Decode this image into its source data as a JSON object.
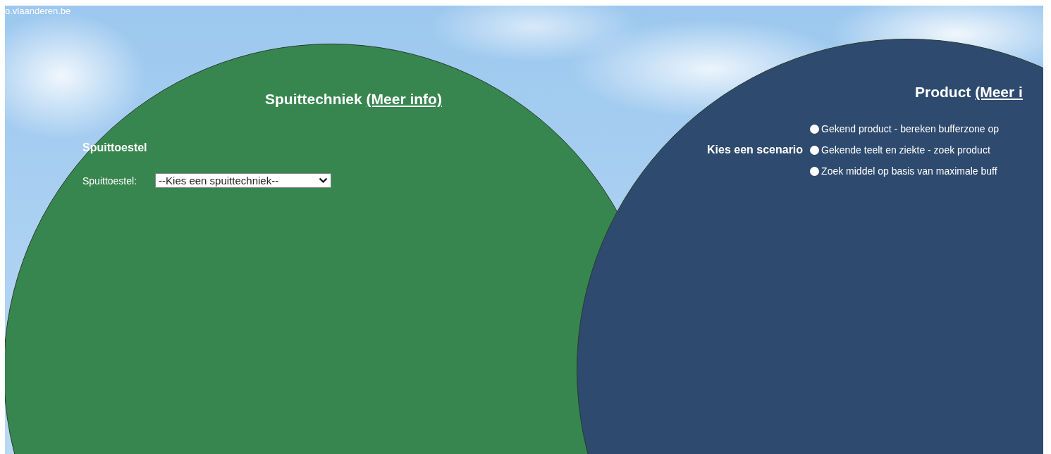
{
  "address_text": "o.vlaanderen.be",
  "spray_panel": {
    "title": "Spuittechniek",
    "info_link": "(Meer info)",
    "section_heading": "Spuittoestel",
    "field_label": "Spuittoestel:",
    "select_value": "--Kies een spuittechniek--"
  },
  "product_panel": {
    "title": "Product",
    "info_link": "(Meer i",
    "scenario_label": "Kies een scenario",
    "scenarios": [
      {
        "label": "Gekend product - bereken bufferzone op",
        "selected": false
      },
      {
        "label": "Gekende teelt en ziekte - zoek product",
        "selected": false
      },
      {
        "label": "Zoek middel op basis van maximale buff",
        "selected": false
      }
    ]
  }
}
